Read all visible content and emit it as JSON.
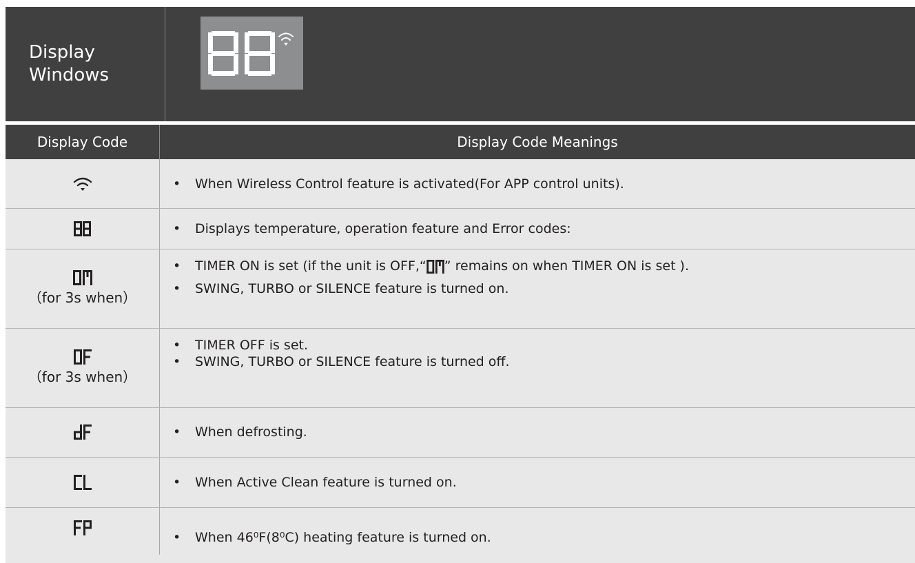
{
  "display_windows": {
    "label_line1": "Display",
    "label_line2": "Windows",
    "panel_digits": "88",
    "panel_icon": "wifi-icon"
  },
  "header": {
    "code": "Display Code",
    "meanings": "Display Code Meanings"
  },
  "rows": [
    {
      "code": "wifi-icon",
      "lines": [
        "When Wireless Control feature is activated(For APP control units)."
      ]
    },
    {
      "code": "88",
      "lines": [
        "Displays  temperature, operation feature and Error codes:"
      ]
    },
    {
      "code": "On",
      "note": "（for 3s when）",
      "line1_a": "TIMER ON is set (if the unit is OFF,“",
      "line1_b": "” remains on when TIMER ON is set ).",
      "line2": "SWING, TURBO or SILENCE feature is turned on."
    },
    {
      "code": "OF",
      "note": "（for 3s when）",
      "lines": [
        "TIMER OFF is set.",
        "SWING, TURBO or SILENCE  feature is turned off."
      ]
    },
    {
      "code": "dF",
      "lines": [
        "When defrosting."
      ]
    },
    {
      "code": "CL",
      "lines": [
        "When Active Clean feature is turned on."
      ]
    },
    {
      "code": "FP",
      "lines": [
        "When 46⁰F(8⁰C) heating feature is turned on."
      ]
    }
  ]
}
